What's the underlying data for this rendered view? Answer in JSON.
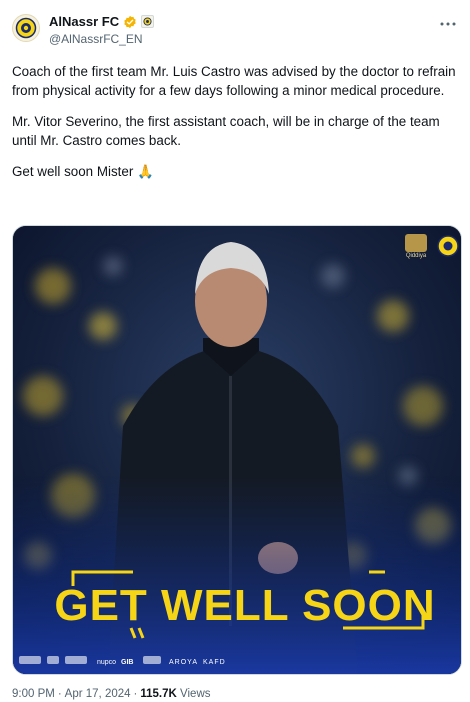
{
  "account": {
    "display_name": "AlNassr FC",
    "handle": "@AlNassrFC_EN"
  },
  "icons": {
    "avatar": "club-crest",
    "verified": "verified-badge",
    "affiliation": "affiliation-badge",
    "more": "more-options-icon"
  },
  "colors": {
    "verified": "#f4b400",
    "headline": "#f5d516",
    "media_bg": "#0c1630"
  },
  "tweet": {
    "paragraph_1": "Coach of the first team Mr. Luis Castro was advised by the doctor to refrain from physical activity for a few days following a minor medical procedure.",
    "paragraph_2": "Mr. Vitor Severino, the first assistant coach, will be in charge of the team until Mr. Castro comes back.",
    "paragraph_3": "Get well soon Mister 🙏"
  },
  "media": {
    "headline": "GET WELL SOON",
    "corner_label": "Qiddiya",
    "sponsors": [
      "KAFD",
      "AROYA",
      "nupco",
      "GIB"
    ]
  },
  "meta": {
    "time": "9:00 PM",
    "date": "Apr 17, 2024",
    "views_count": "115.7K",
    "views_label": "Views"
  }
}
